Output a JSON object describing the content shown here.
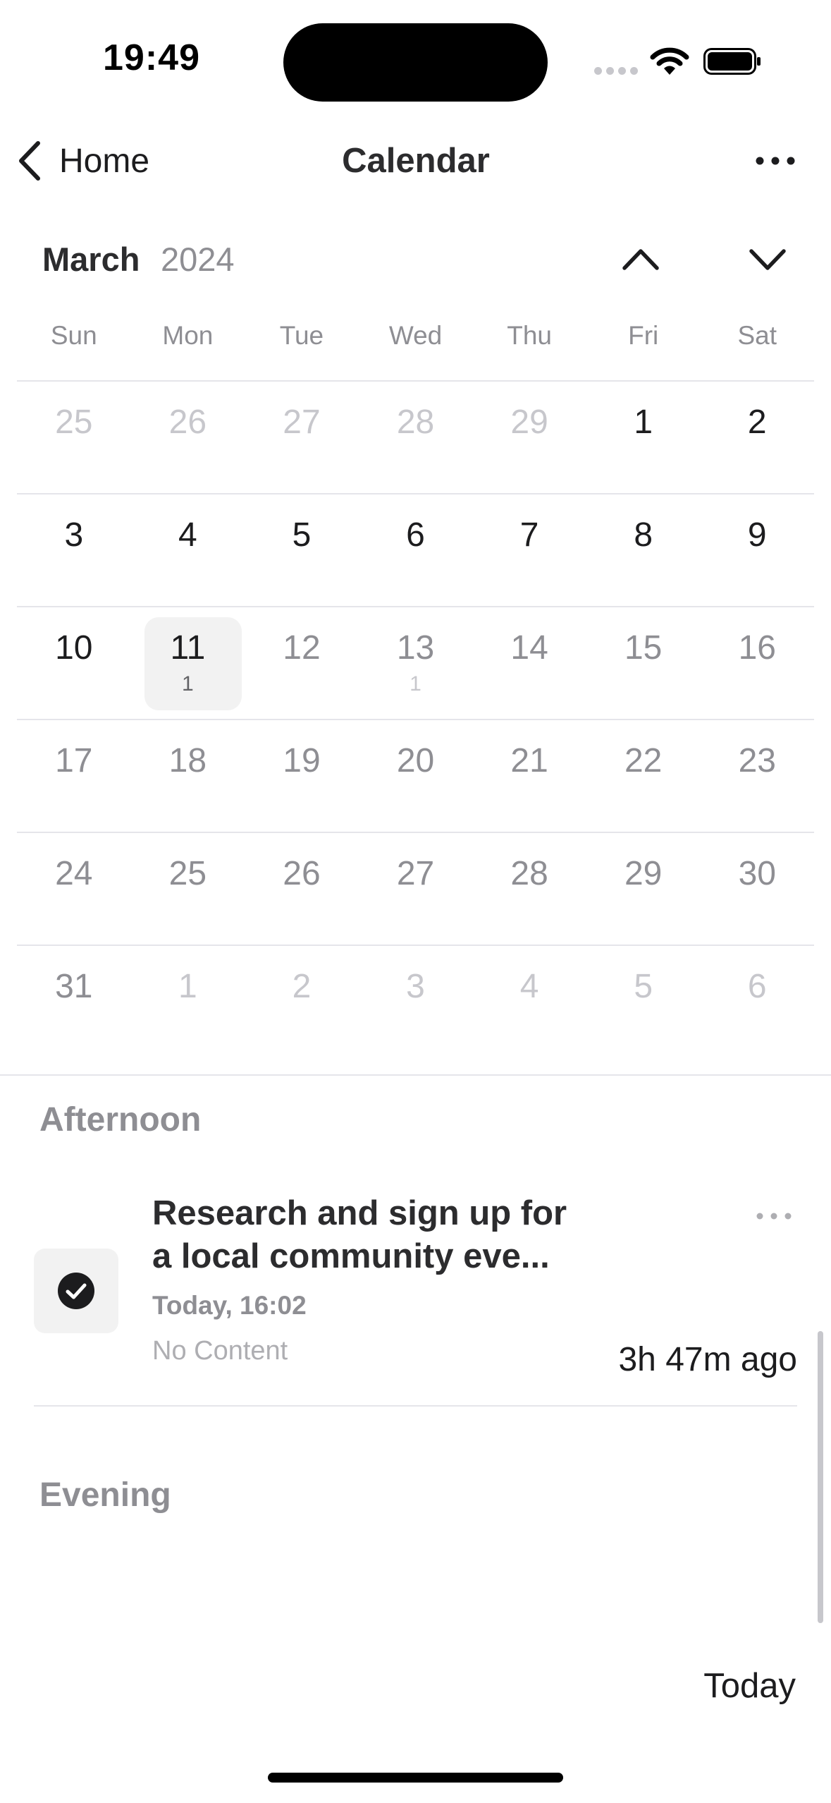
{
  "status_bar": {
    "time": "19:49"
  },
  "nav": {
    "back_label": "Home",
    "title": "Calendar"
  },
  "month_header": {
    "month": "March",
    "year": "2024"
  },
  "weekdays": [
    "Sun",
    "Mon",
    "Tue",
    "Wed",
    "Thu",
    "Fri",
    "Sat"
  ],
  "weeks": [
    [
      {
        "day": "25",
        "state": "other"
      },
      {
        "day": "26",
        "state": "other"
      },
      {
        "day": "27",
        "state": "other"
      },
      {
        "day": "28",
        "state": "other"
      },
      {
        "day": "29",
        "state": "other"
      },
      {
        "day": "1",
        "state": "past"
      },
      {
        "day": "2",
        "state": "past"
      }
    ],
    [
      {
        "day": "3",
        "state": "past"
      },
      {
        "day": "4",
        "state": "past"
      },
      {
        "day": "5",
        "state": "past"
      },
      {
        "day": "6",
        "state": "past"
      },
      {
        "day": "7",
        "state": "past"
      },
      {
        "day": "8",
        "state": "past"
      },
      {
        "day": "9",
        "state": "past"
      }
    ],
    [
      {
        "day": "10",
        "state": "past"
      },
      {
        "day": "11",
        "state": "today",
        "count": "1"
      },
      {
        "day": "12",
        "state": "future"
      },
      {
        "day": "13",
        "state": "future",
        "count": "1"
      },
      {
        "day": "14",
        "state": "future"
      },
      {
        "day": "15",
        "state": "future"
      },
      {
        "day": "16",
        "state": "future"
      }
    ],
    [
      {
        "day": "17",
        "state": "future"
      },
      {
        "day": "18",
        "state": "future"
      },
      {
        "day": "19",
        "state": "future"
      },
      {
        "day": "20",
        "state": "future"
      },
      {
        "day": "21",
        "state": "future"
      },
      {
        "day": "22",
        "state": "future"
      },
      {
        "day": "23",
        "state": "future"
      }
    ],
    [
      {
        "day": "24",
        "state": "future"
      },
      {
        "day": "25",
        "state": "future"
      },
      {
        "day": "26",
        "state": "future"
      },
      {
        "day": "27",
        "state": "future"
      },
      {
        "day": "28",
        "state": "future"
      },
      {
        "day": "29",
        "state": "future"
      },
      {
        "day": "30",
        "state": "future"
      }
    ],
    [
      {
        "day": "31",
        "state": "future"
      },
      {
        "day": "1",
        "state": "other"
      },
      {
        "day": "2",
        "state": "other"
      },
      {
        "day": "3",
        "state": "other"
      },
      {
        "day": "4",
        "state": "other"
      },
      {
        "day": "5",
        "state": "other"
      },
      {
        "day": "6",
        "state": "other"
      }
    ]
  ],
  "sections": {
    "afternoon_title": "Afternoon",
    "evening_title": "Evening"
  },
  "task": {
    "title_line1": "Research and sign up for",
    "title_line2": "a local community eve...",
    "date": "Today, 16:02",
    "content": "No Content",
    "relative_time": "3h 47m ago",
    "completed": true,
    "icon": "checkmark-circle-icon"
  },
  "footer": {
    "today_label": "Today"
  },
  "icons": {
    "back": "chevron-left-icon",
    "more": "ellipsis-icon",
    "prev_month": "chevron-up-icon",
    "next_month": "chevron-down-icon"
  }
}
